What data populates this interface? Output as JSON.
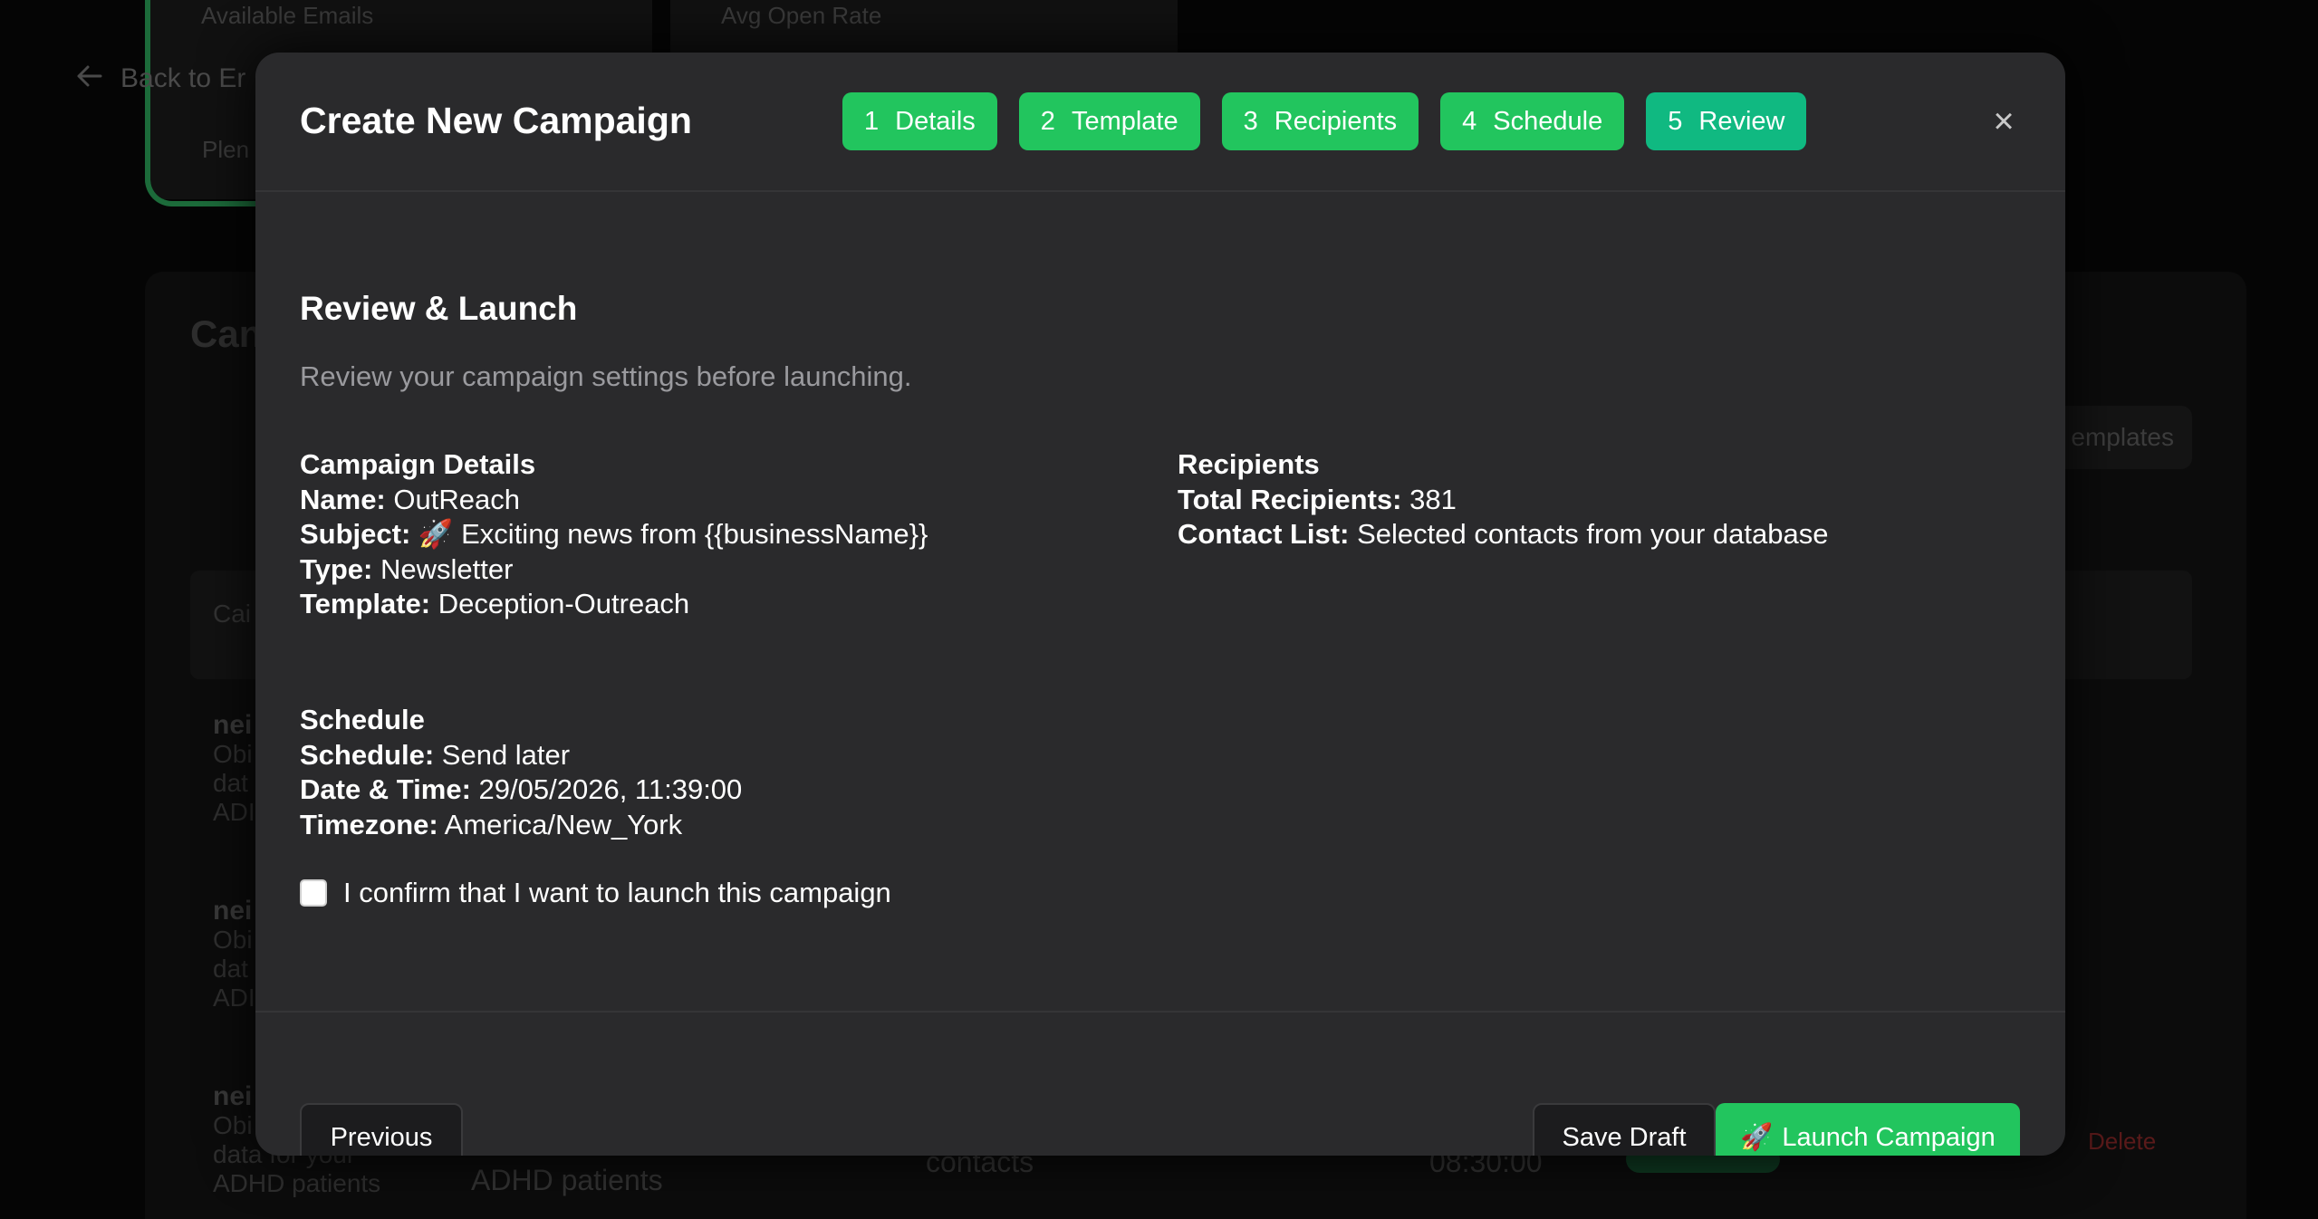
{
  "background": {
    "stat_labels": [
      "Available Emails",
      "Avg Open Rate"
    ],
    "back_link": "Back to Er",
    "plan_text": "Plen",
    "panel_title": "Can",
    "templates_button": "emplates",
    "table_head": "Cai",
    "rows": [
      {
        "name": "nei",
        "lines": [
          "Obi",
          "dat",
          "ADI"
        ]
      },
      {
        "name": "nei",
        "lines": [
          "Obi",
          "dat",
          "ADI"
        ]
      },
      {
        "name": "nei",
        "lines": [
          "Obi",
          "data for your",
          "ADHD patients"
        ]
      }
    ],
    "row_cells": {
      "audience": "ADHD patients",
      "list": "contacts",
      "time": "08:30:00"
    },
    "delete_label": "Delete"
  },
  "modal": {
    "title": "Create New Campaign",
    "steps": [
      {
        "number": "1",
        "label": "Details"
      },
      {
        "number": "2",
        "label": "Template"
      },
      {
        "number": "3",
        "label": "Recipients"
      },
      {
        "number": "4",
        "label": "Schedule"
      },
      {
        "number": "5",
        "label": "Review"
      }
    ],
    "close_icon": "×",
    "section_title": "Review & Launch",
    "section_subtitle": "Review your campaign settings before launching.",
    "details": {
      "title": "Campaign Details",
      "name_label": "Name:",
      "name_value": "OutReach",
      "subject_label": "Subject:",
      "subject_value": "🚀 Exciting news from {{businessName}}",
      "type_label": "Type:",
      "type_value": "Newsletter",
      "template_label": "Template:",
      "template_value": "Deception-Outreach"
    },
    "recipients": {
      "title": "Recipients",
      "total_label": "Total Recipients:",
      "total_value": "381",
      "list_label": "Contact List:",
      "list_value": "Selected contacts from your database"
    },
    "schedule": {
      "title": "Schedule",
      "schedule_label": "Schedule:",
      "schedule_value": "Send later",
      "datetime_label": "Date & Time:",
      "datetime_value": "29/05/2026, 11:39:00",
      "timezone_label": "Timezone:",
      "timezone_value": "America/New_York"
    },
    "confirm_label": "I confirm that I want to launch this campaign",
    "confirm_checked": false,
    "footer": {
      "previous": "Previous",
      "save_draft": "Save Draft",
      "launch_icon": "🚀",
      "launch": "Launch Campaign"
    }
  },
  "colors": {
    "accent_green": "#22c55e",
    "active_step": "#10b981",
    "modal_bg": "#2a2a2c"
  }
}
